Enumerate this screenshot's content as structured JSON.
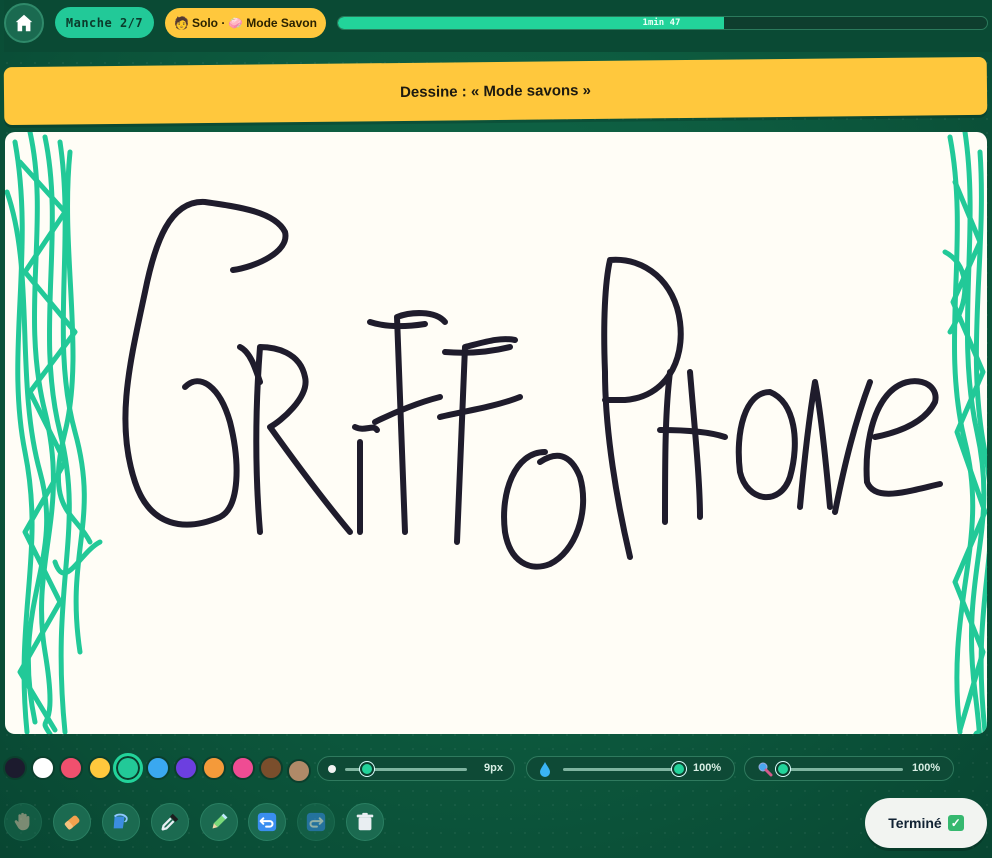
{
  "header": {
    "round": "Manche 2/7",
    "mode_emoji_left": "🧑",
    "mode_text": "Solo · ",
    "mode_emoji_right": "🧼",
    "mode_name": "Mode Savon",
    "timer_label": "1min 47",
    "timer_progress": 0.595
  },
  "prompt": {
    "text": "Dessine : « Mode savons »"
  },
  "canvas": {
    "drawn_word": "GriffoPhone"
  },
  "palette": {
    "colors": [
      "#1c1b2e",
      "#ffffff",
      "#f0506e",
      "#ffc83d",
      "#22c998",
      "#3aa8f0",
      "#6c3fe0",
      "#f49a3a",
      "#ef4c93",
      "#7a4e2c",
      "#b08a68"
    ],
    "selected_index": 4
  },
  "sliders": {
    "size_value": "9px",
    "size_level": 0.18,
    "opacity_value": "100%",
    "opacity_level": 1.0,
    "zoom_value": "100%",
    "zoom_level": 0.0
  },
  "tools": {
    "items": [
      "hand-tool",
      "eraser-tool",
      "fill-tool",
      "eyedropper-tool",
      "marker-tool",
      "undo",
      "redo",
      "clear"
    ]
  },
  "done_button": {
    "label": "Terminé"
  }
}
